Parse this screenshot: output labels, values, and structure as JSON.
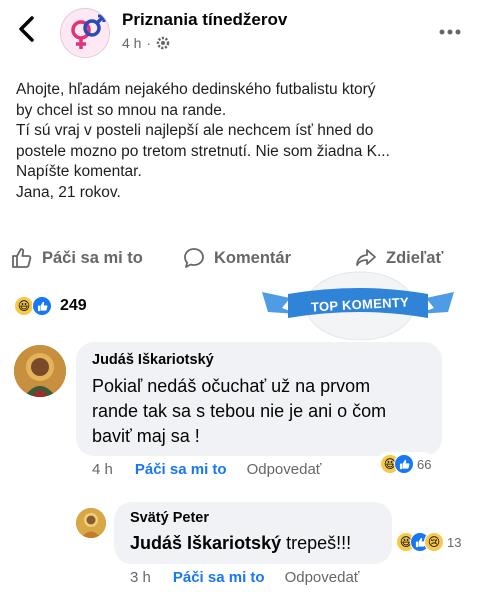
{
  "header": {
    "back_icon": "chevron-left-icon",
    "page_name": "Priznania tínedžerov",
    "time": "4 h",
    "privacy_icon": "gear-icon",
    "more_icon": "more-horizontal-icon"
  },
  "post": {
    "lines": [
      "Ahojte, hľadám nejakého dedinského futbalistu ktorý",
      "by chcel ist so mnou na rande.",
      "Tí sú vraj v posteli najlepší ale nechcem ísť hned do",
      "postele mozno po tretom stretnutí. Nie som žiadna K...",
      "Napíšte komentar.",
      "Jana, 21 rokov."
    ]
  },
  "actions": {
    "like": "Páči sa mi to",
    "comment": "Komentár",
    "share": "Zdieľať"
  },
  "reactions": {
    "count": "249"
  },
  "badge": {
    "label": "TOP KOMENTY"
  },
  "comments": [
    {
      "author": "Judáš Iškariotský",
      "text_lines": [
        "Pokiaľ nedáš očuchať už na prvom",
        "rande tak sa s tebou nie je ani o čom",
        "baviť maj sa !"
      ],
      "time": "4 h",
      "like": "Páči sa mi to",
      "reply": "Odpovedať",
      "reaction_count": "66"
    },
    {
      "author": "Svätý Peter",
      "text_bold": "Judáš Iškariotský",
      "text_rest": " trepeš!!!",
      "time": "3 h",
      "like": "Páči sa mi to",
      "reply": "Odpovedať",
      "reaction_count": "13"
    }
  ],
  "colors": {
    "accent": "#1877f2",
    "muted": "#65676b",
    "bubble": "#f0f2f5"
  }
}
